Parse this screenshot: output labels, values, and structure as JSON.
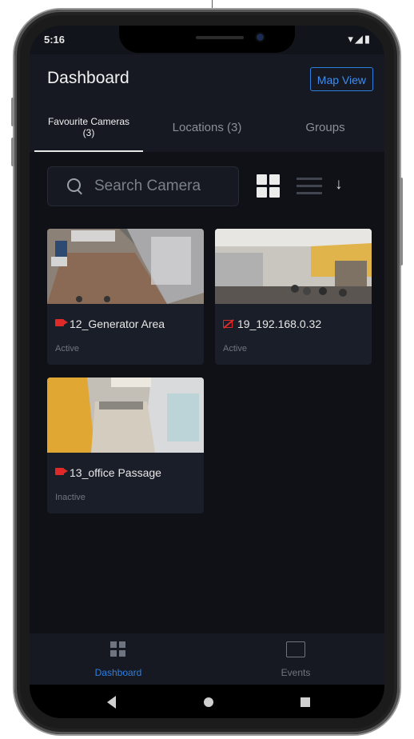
{
  "status_bar": {
    "time": "5:16",
    "icons": "▾◢▮"
  },
  "header": {
    "title": "Dashboard",
    "map_view_label": "Map View"
  },
  "tabs": [
    {
      "label": "Favourite Cameras (3)",
      "active": true
    },
    {
      "label": "Locations (3)",
      "active": false
    },
    {
      "label": "Groups",
      "active": false
    }
  ],
  "search": {
    "placeholder": "Search Camera"
  },
  "view_toggle": {
    "grid": "grid-icon",
    "list": "list-icon",
    "sort": "↓"
  },
  "cameras": [
    {
      "name": "12_Generator Area",
      "status": "Active",
      "online": true
    },
    {
      "name": "19_192.168.0.32",
      "status": "Active",
      "online": false
    },
    {
      "name": "13_office Passage",
      "status": "Inactive",
      "online": true
    }
  ],
  "bottom_nav": [
    {
      "label": "Dashboard",
      "active": true
    },
    {
      "label": "Events",
      "active": false
    }
  ],
  "colors": {
    "accent": "#2d7fe0",
    "background": "#0f1117",
    "surface": "#1a1e28",
    "record_red": "#e02a2a"
  }
}
